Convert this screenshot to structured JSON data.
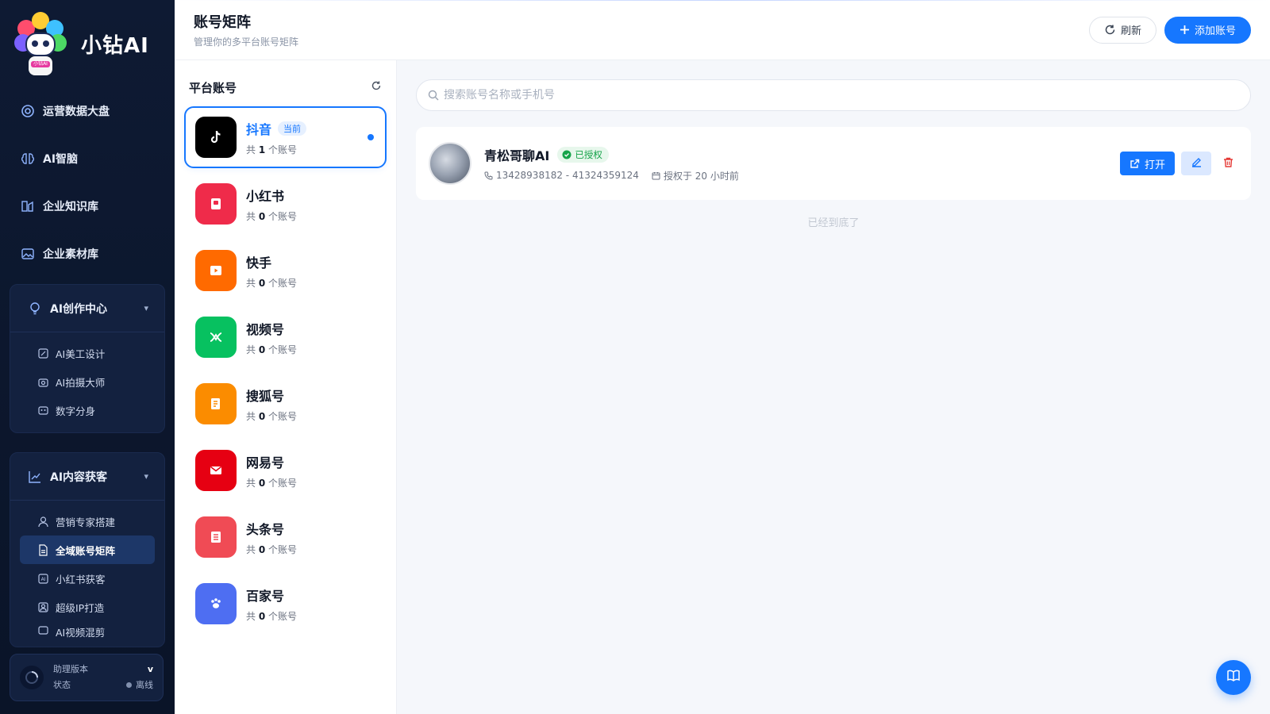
{
  "brand": {
    "name": "小钻AI",
    "logo_tag": "小钻AI"
  },
  "nav": [
    {
      "label": "运营数据大盘",
      "icon": "dashboard-icon"
    },
    {
      "label": "AI智脑",
      "icon": "brain-icon"
    },
    {
      "label": "企业知识库",
      "icon": "knowledge-icon"
    },
    {
      "label": "企业素材库",
      "icon": "image-icon"
    }
  ],
  "group_create": {
    "label": "AI创作中心",
    "items": [
      {
        "label": "AI美工设计",
        "icon": "palette-icon"
      },
      {
        "label": "AI拍摄大师",
        "icon": "camera-icon"
      },
      {
        "label": "数字分身",
        "icon": "avatar-icon"
      }
    ]
  },
  "group_content": {
    "label": "AI内容获客",
    "items": [
      {
        "label": "营销专家搭建",
        "icon": "user-icon"
      },
      {
        "label": "全域账号矩阵",
        "icon": "file-icon",
        "active": true
      },
      {
        "label": "小红书获客",
        "icon": "ai-box-icon"
      },
      {
        "label": "超级IP打造",
        "icon": "ip-icon"
      },
      {
        "label": "AI视频混剪",
        "icon": "video-icon"
      }
    ]
  },
  "footer": {
    "version_label": "助理版本",
    "version_value": "v",
    "status_label": "状态",
    "status_value": "离线"
  },
  "header": {
    "title": "账号矩阵",
    "subtitle": "管理你的多平台账号矩阵",
    "refresh_label": "刷新",
    "add_label": "添加账号"
  },
  "platforms": {
    "title": "平台账号",
    "current_badge": "当前",
    "count_prefix": "共",
    "count_suffix": "个账号",
    "items": [
      {
        "name": "抖音",
        "count": "1",
        "color": "#000000"
      },
      {
        "name": "小红书",
        "count": "0",
        "color": "#ef2b4a"
      },
      {
        "name": "快手",
        "count": "0",
        "color": "#ff6a00"
      },
      {
        "name": "视频号",
        "count": "0",
        "color": "#07c160"
      },
      {
        "name": "搜狐号",
        "count": "0",
        "color": "#fb8c00"
      },
      {
        "name": "网易号",
        "count": "0",
        "color": "#e60012"
      },
      {
        "name": "头条号",
        "count": "0",
        "color": "#f04b55"
      },
      {
        "name": "百家号",
        "count": "0",
        "color": "#4e6ef2"
      }
    ]
  },
  "search": {
    "placeholder": "搜索账号名称或手机号"
  },
  "account": {
    "name": "青松哥聊AI",
    "auth_label": "已授权",
    "phone": "13428938182 - 41324359124",
    "auth_time": "授权于 20 小时前",
    "open_label": "打开"
  },
  "list_end": "已经到底了",
  "colors": {
    "accent": "#1677ff",
    "sidebar_bg": "#0e1a33",
    "success": "#16a34a",
    "danger": "#e53935"
  }
}
